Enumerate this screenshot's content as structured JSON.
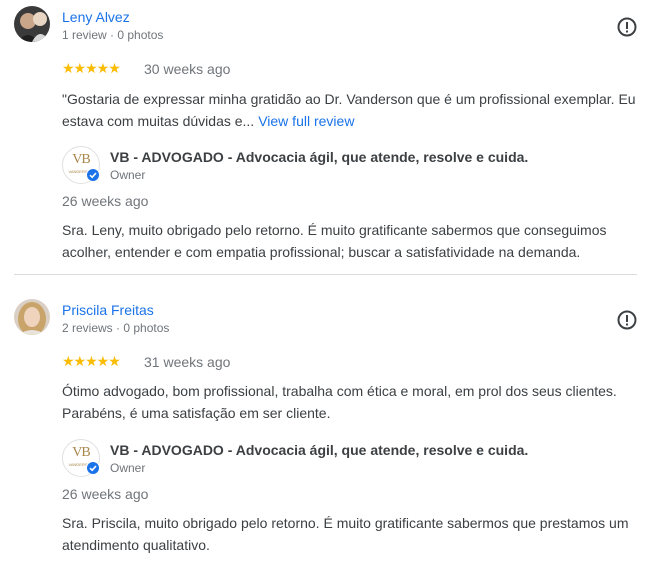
{
  "reviews": [
    {
      "name": "Leny Alvez",
      "meta": "1 review · 0 photos",
      "stars": "★★★★★",
      "date": "30 weeks ago",
      "text": "\"Gostaria de expressar minha gratidão ao Dr. Vanderson que é um profissional exemplar. Eu estava com muitas dúvidas e...",
      "more": "View full review",
      "owner_name": "VB - ADVOGADO - Advocacia ágil, que atende, resolve e cuida.",
      "owner_role": "Owner",
      "reply_date": "26 weeks ago",
      "reply_text": "Sra. Leny, muito obrigado pelo retorno. É muito gratificante sabermos que conseguimos acolher, entender e com empatia profissional; buscar a satisfatividade na demanda."
    },
    {
      "name": "Priscila Freitas",
      "meta": "2 reviews · 0 photos",
      "stars": "★★★★★",
      "date": "31 weeks ago",
      "text": "Ótimo advogado, bom profissional, trabalha com ética e moral, em prol dos seus clientes. Parabéns, é uma satisfação em ser cliente.",
      "owner_name": "VB - ADVOGADO - Advocacia ágil, que atende, resolve e cuida.",
      "owner_role": "Owner",
      "reply_date": "26 weeks ago",
      "reply_text": "Sra. Priscila, muito obrigado pelo retorno. É muito gratificante sabermos que prestamos um atendimento qualitativo."
    }
  ],
  "logo": {
    "monogram": "VB",
    "small_text": "VANDERSON"
  },
  "icons": {
    "flag": "report-icon",
    "verified": "verified-badge-icon"
  },
  "colors": {
    "accent": "#1a73e8",
    "star": "#fbbc04",
    "logo_gold": "#a8874a"
  }
}
